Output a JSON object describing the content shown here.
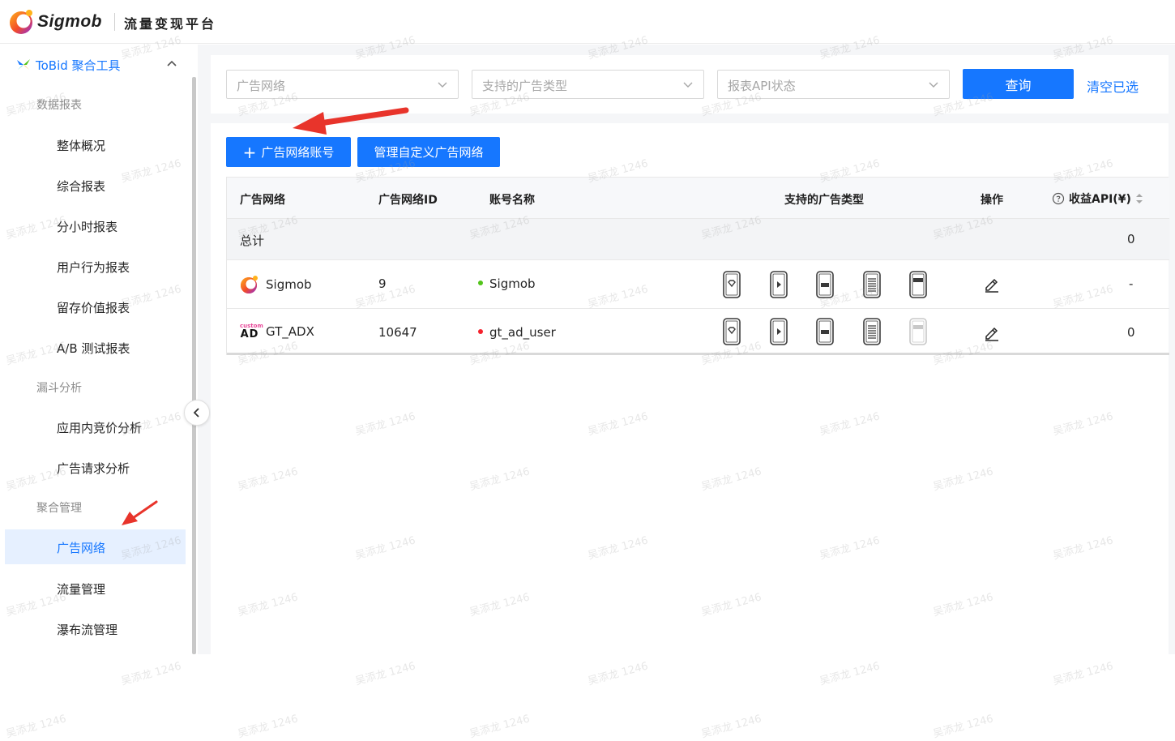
{
  "header": {
    "logo_text": "Sigmob",
    "platform_title": "流量变现平台"
  },
  "sidebar": {
    "section_title": "ToBid 聚合工具",
    "groups": [
      {
        "label": "数据报表"
      },
      {
        "label": "漏斗分析"
      },
      {
        "label": "聚合管理"
      }
    ],
    "items": [
      {
        "label": "整体概况"
      },
      {
        "label": "综合报表"
      },
      {
        "label": "分小时报表"
      },
      {
        "label": "用户行为报表"
      },
      {
        "label": "留存价值报表"
      },
      {
        "label": "A/B 测试报表"
      },
      {
        "label": "应用内竞价分析"
      },
      {
        "label": "广告请求分析"
      },
      {
        "label": "广告网络"
      },
      {
        "label": "流量管理"
      },
      {
        "label": "瀑布流管理"
      }
    ],
    "active_item": "广告网络"
  },
  "filters": {
    "network_placeholder": "广告网络",
    "adtype_placeholder": "支持的广告类型",
    "api_status_placeholder": "报表API状态",
    "query_label": "查询",
    "clear_label": "清空已选"
  },
  "toolbar": {
    "add_account_label": "广告网络账号",
    "manage_custom_label": "管理自定义广告网络"
  },
  "table": {
    "headers": {
      "network": "广告网络",
      "network_id": "广告网络ID",
      "account_name": "账号名称",
      "ad_types": "支持的广告类型",
      "actions": "操作",
      "revenue_api": "收益API(¥)"
    },
    "total": {
      "label": "总计",
      "revenue_api": "0"
    },
    "rows": [
      {
        "network": "Sigmob",
        "network_id": "9",
        "account_name": "Sigmob",
        "account_status_color": "#52c41a",
        "revenue_api": "-",
        "ad_types": [
          "splash",
          "rewarded-video",
          "interstitial",
          "native",
          "banner"
        ],
        "disabled_types": []
      },
      {
        "network": "GT_ADX",
        "network_id": "10647",
        "account_name": "gt_ad_user",
        "account_status_color": "#f5222d",
        "revenue_api": "0",
        "ad_types": [
          "splash",
          "rewarded-video",
          "interstitial",
          "native",
          "banner"
        ],
        "disabled_types": [
          "banner"
        ]
      }
    ]
  },
  "colors": {
    "primary": "#1677ff",
    "active_bg": "#e6f0ff",
    "annotation_arrow": "#e8342b"
  },
  "watermark_text": "吴添龙 1246"
}
